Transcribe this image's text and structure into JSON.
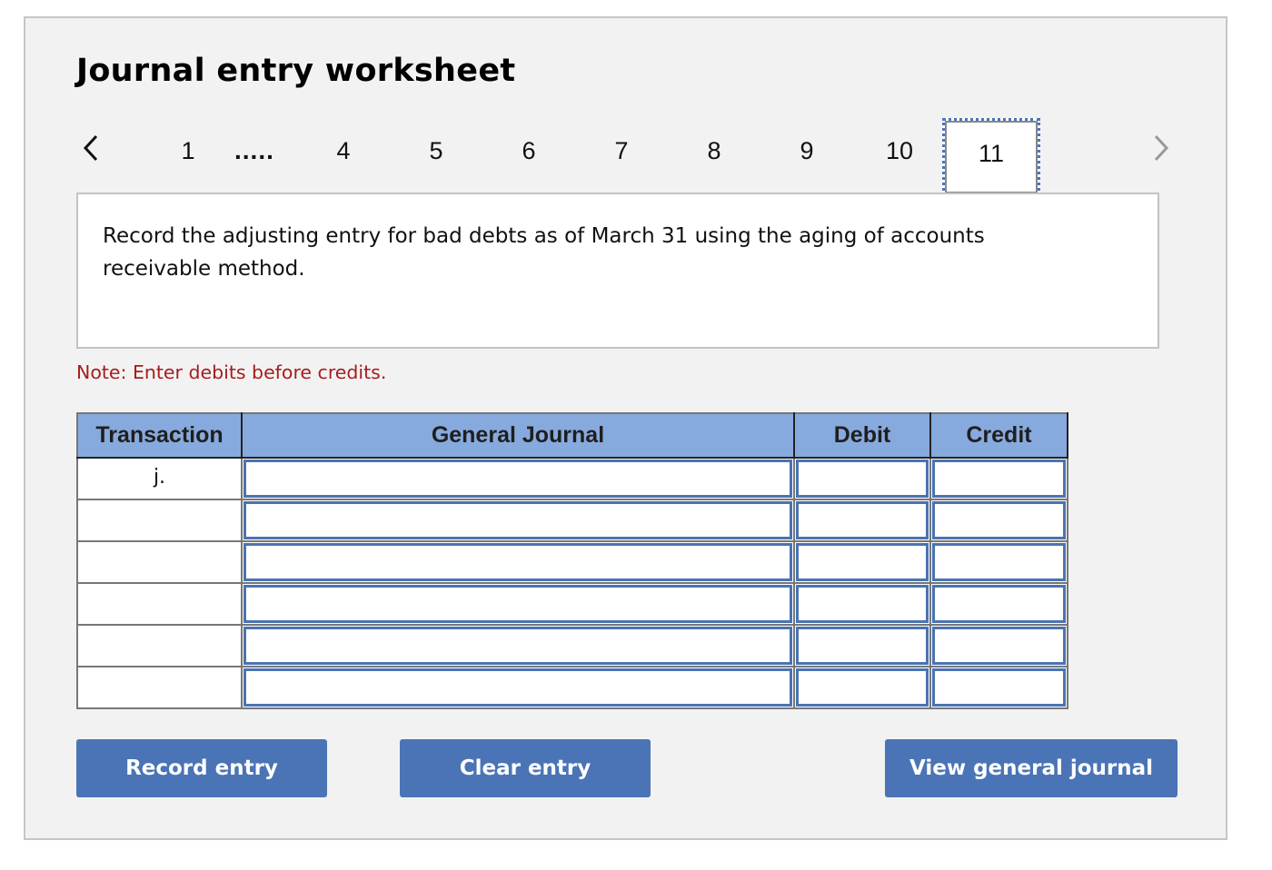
{
  "worksheet": {
    "title": "Journal entry worksheet"
  },
  "pager": {
    "prev_icon": "chevron-left-icon",
    "next_icon": "chevron-right-icon",
    "first_page": "1",
    "ellipsis": ".....",
    "pages": [
      "4",
      "5",
      "6",
      "7",
      "8",
      "9",
      "10",
      "11"
    ],
    "active_page": "11"
  },
  "prompt": {
    "text": "Record the adjusting entry for bad debts as of March 31 using the aging of accounts receivable method."
  },
  "note": "Note: Enter debits before credits.",
  "table": {
    "headers": [
      "Transaction",
      "General Journal",
      "Debit",
      "Credit"
    ],
    "rows": [
      {
        "transaction": "j.",
        "account": "",
        "debit": "",
        "credit": ""
      },
      {
        "transaction": "",
        "account": "",
        "debit": "",
        "credit": ""
      },
      {
        "transaction": "",
        "account": "",
        "debit": "",
        "credit": ""
      },
      {
        "transaction": "",
        "account": "",
        "debit": "",
        "credit": ""
      },
      {
        "transaction": "",
        "account": "",
        "debit": "",
        "credit": ""
      },
      {
        "transaction": "",
        "account": "",
        "debit": "",
        "credit": ""
      }
    ]
  },
  "buttons": {
    "record": "Record entry",
    "clear": "Clear entry",
    "view": "View general journal"
  },
  "colors": {
    "accent": "#4a74b5",
    "header_bg": "#87aade",
    "note": "#a51d1d",
    "panel_bg": "#f2f2f2"
  }
}
